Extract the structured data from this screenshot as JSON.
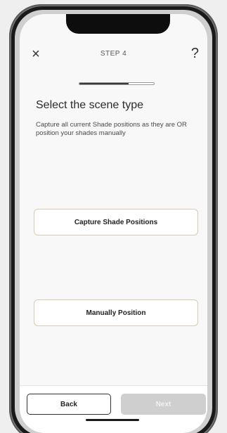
{
  "header": {
    "close_icon": "×",
    "step_label": "STEP 4",
    "help_icon": "?"
  },
  "progress": {
    "fraction": 0.66
  },
  "content": {
    "title": "Select the scene type",
    "description": "Capture all current Shade positions as they are OR position your shades manually"
  },
  "options": {
    "capture_label": "Capture Shade Positions",
    "manual_label": "Manually Position"
  },
  "footer": {
    "back_label": "Back",
    "next_label": "Next"
  },
  "colors": {
    "accent_border": "#d9cbb0",
    "disabled_button": "#cfcfcf",
    "progress_fill": "#3a3a3a"
  }
}
